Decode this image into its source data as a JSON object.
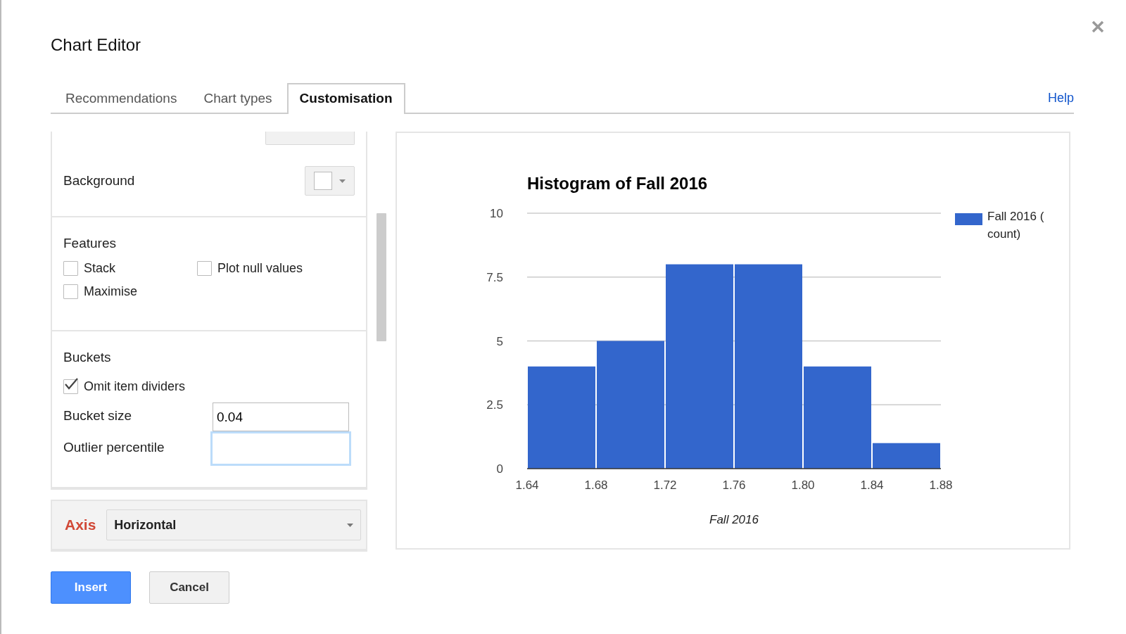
{
  "dialog": {
    "title": "Chart Editor"
  },
  "tabs": [
    {
      "label": "Recommendations",
      "selected": false
    },
    {
      "label": "Chart types",
      "selected": false
    },
    {
      "label": "Customisation",
      "selected": true
    }
  ],
  "help_link": "Help",
  "background": {
    "label": "Background"
  },
  "features": {
    "heading": "Features",
    "options": [
      {
        "label": "Stack",
        "checked": false
      },
      {
        "label": "Plot null values",
        "checked": false
      },
      {
        "label": "Maximise",
        "checked": false
      }
    ]
  },
  "buckets": {
    "heading": "Buckets",
    "options": [
      {
        "label": "Omit item dividers",
        "checked": true
      }
    ],
    "fields": [
      {
        "label": "Bucket size",
        "value": "0.04",
        "focused": false
      },
      {
        "label": "Outlier percentile",
        "focused": true
      }
    ]
  },
  "axis": {
    "label": "Axis",
    "value": "Horizontal"
  },
  "chart": {
    "chart_data": {
      "type": "bar",
      "title": "Histogram of Fall 2016",
      "xlabel": "Fall 2016",
      "x": [
        1.66,
        1.7,
        1.74,
        1.78,
        1.82,
        1.86
      ],
      "grid": true,
      "series": [
        {
          "name": "Fall 2016 ( count)",
          "color": "#3366cc",
          "values": [
            4,
            5,
            8,
            8,
            4,
            1
          ]
        }
      ],
      "xlim": [
        1.64,
        1.88
      ],
      "ylim": [
        0,
        10
      ],
      "xticks": [
        {
          "value": 1.64,
          "label": "1.64"
        },
        {
          "value": 1.68,
          "label": "1.68"
        },
        {
          "value": 1.72,
          "label": "1.72"
        },
        {
          "value": 1.76,
          "label": "1.76"
        },
        {
          "value": 1.8,
          "label": "1.80"
        },
        {
          "value": 1.84,
          "label": "1.84"
        },
        {
          "value": 1.88,
          "label": "1.88"
        }
      ],
      "yticks": [
        {
          "value": 0,
          "label": "0"
        },
        {
          "value": 2.5,
          "label": "2.5"
        },
        {
          "value": 5,
          "label": "5"
        },
        {
          "value": 7.5,
          "label": "7.5"
        },
        {
          "value": 10,
          "label": "10"
        }
      ]
    }
  },
  "buttons": [
    {
      "label": "Insert",
      "kind": "primary"
    },
    {
      "label": "Cancel",
      "kind": "secondary"
    }
  ]
}
